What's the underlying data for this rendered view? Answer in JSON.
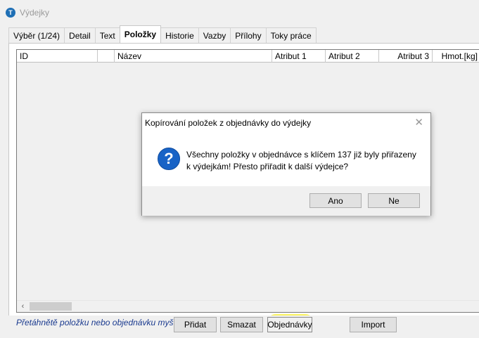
{
  "window": {
    "title": "Výdejky",
    "icon": "app-logo-icon"
  },
  "tabs": [
    {
      "label": "Výběr (1/24)",
      "active": false
    },
    {
      "label": "Detail",
      "active": false
    },
    {
      "label": "Text",
      "active": false
    },
    {
      "label": "Položky",
      "active": true
    },
    {
      "label": "Historie",
      "active": false
    },
    {
      "label": "Vazby",
      "active": false
    },
    {
      "label": "Přílohy",
      "active": false
    },
    {
      "label": "Toky práce",
      "active": false
    }
  ],
  "grid": {
    "columns": [
      "ID",
      "",
      "Název",
      "Atribut 1",
      "Atribut 2",
      "Atribut 3",
      "Hmot.[kg]"
    ],
    "rows": []
  },
  "scrollbar": {
    "left_icon": "chevron-left-icon",
    "left_glyph": "‹"
  },
  "bottom": {
    "hint": "Přetáhnětě položku nebo objednávku myší!",
    "buttons": [
      "Přidat",
      "Smazat",
      "Objednávky",
      "Import"
    ]
  },
  "dialog": {
    "title": "Kopírování položek z objednávky do výdejky",
    "close_glyph": "✕",
    "icon": "question-icon",
    "message": "Všechny položky v objednávce s klíčem 137 již byly přiřazeny k výdejkám! Přesto přiřadit k další výdejce?",
    "buttons": [
      "Ano",
      "Ne"
    ]
  },
  "colors": {
    "accent": "#1863c6",
    "highlight": "#f8f14a",
    "hint_text": "#1a3a8f"
  }
}
